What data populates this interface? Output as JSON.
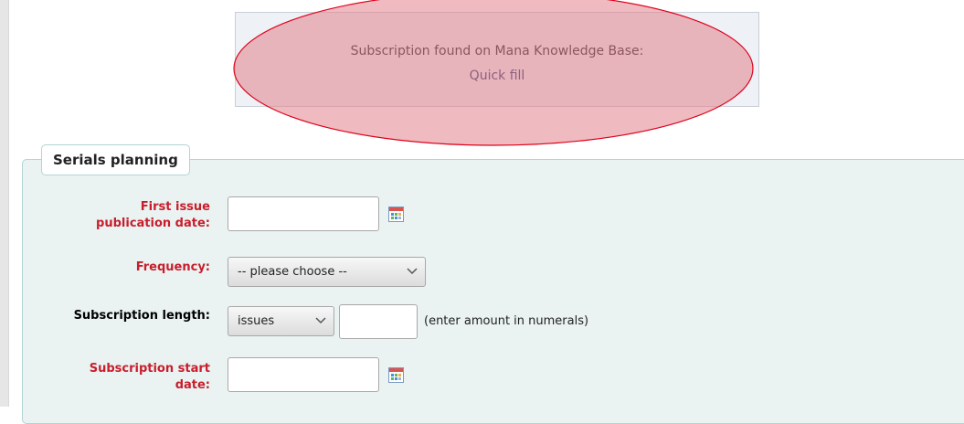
{
  "mana_notice": {
    "message": "Subscription found on Mana Knowledge Base:",
    "quick_fill_label": "Quick fill"
  },
  "serials_planning": {
    "legend": "Serials planning",
    "first_issue": {
      "label_line1": "First issue",
      "label_line2": "publication date:",
      "value": "",
      "calendar_icon": "calendar-icon"
    },
    "frequency": {
      "label": "Frequency:",
      "selected": "-- please choose --"
    },
    "subscription_length": {
      "label": "Subscription length:",
      "unit_selected": "issues",
      "amount_value": "",
      "hint": "(enter amount in numerals)"
    },
    "subscription_start": {
      "label_line1": "Subscription start",
      "label_line2": "date:",
      "value": "",
      "calendar_icon": "calendar-icon"
    }
  },
  "colors": {
    "required_label": "#c81e2c",
    "fieldset_bg": "#eaf2f2",
    "fieldset_border": "#b3d4d4",
    "link": "#22356f",
    "highlight_fill": "#e8a0a8",
    "highlight_stroke": "#e0001a"
  }
}
